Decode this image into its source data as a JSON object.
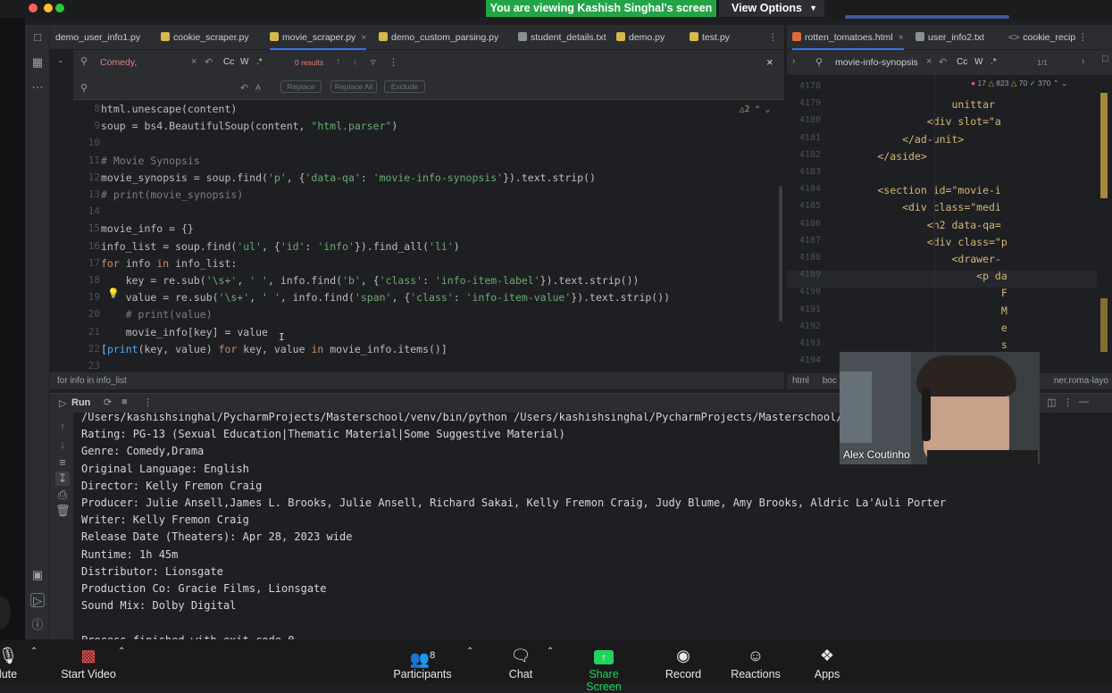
{
  "zoom": {
    "banner_text": "You are viewing Kashish Singhal's screen",
    "view_options_label": "View Options",
    "participant_name": "Alex Coutinho",
    "participant_count": "8",
    "toolbar": [
      {
        "label": "Mute",
        "icon": "microphone-icon",
        "shown": "lute"
      },
      {
        "label": "Start Video",
        "icon": "video-off-icon"
      },
      {
        "label": "Participants",
        "icon": "participants-icon"
      },
      {
        "label": "Chat",
        "icon": "chat-icon"
      },
      {
        "label": "Share Screen",
        "icon": "share-screen-icon"
      },
      {
        "label": "Record",
        "icon": "record-icon"
      },
      {
        "label": "Reactions",
        "icon": "reactions-icon"
      },
      {
        "label": "Apps",
        "icon": "apps-icon"
      }
    ]
  },
  "ide": {
    "tabs": [
      "demo_user_info1.py",
      "cookie_scraper.py",
      "movie_scraper.py",
      "demo_custom_parsing.py",
      "student_details.txt",
      "demo.py",
      "test.py"
    ],
    "active_tab": "movie_scraper.py",
    "search": {
      "find_value": "Comedy,",
      "results": "0 results",
      "replace_buttons": [
        "Replace",
        "Replace All",
        "Exclude"
      ],
      "option_case": "Cc",
      "option_word": "W",
      "option_regex": ".*"
    },
    "inspection_count": "2",
    "code_lines": [
      {
        "n": "8",
        "text": "html.unescape(content)"
      },
      {
        "n": "9",
        "text": "soup = bs4.BeautifulSoup(content, \"html.parser\")"
      },
      {
        "n": "10",
        "text": ""
      },
      {
        "n": "11",
        "text": "# Movie Synopsis"
      },
      {
        "n": "12",
        "text": "movie_synopsis = soup.find('p', {'data-qa': 'movie-info-synopsis'}).text.strip()"
      },
      {
        "n": "13",
        "text": "# print(movie_synopsis)"
      },
      {
        "n": "14",
        "text": ""
      },
      {
        "n": "15",
        "text": "movie_info = {}"
      },
      {
        "n": "16",
        "text": "info_list = soup.find('ul', {'id': 'info'}).find_all('li')"
      },
      {
        "n": "17",
        "text": "for info in info_list:"
      },
      {
        "n": "18",
        "text": "    key = re.sub('\\s+', ' ', info.find('b', {'class': 'info-item-label'}).text.strip())"
      },
      {
        "n": "19",
        "text": "    value = re.sub('\\s+', ' ', info.find('span', {'class': 'info-item-value'}).text.strip())"
      },
      {
        "n": "20",
        "text": "    # print(value)"
      },
      {
        "n": "21",
        "text": "    movie_info[key] = value"
      },
      {
        "n": "22",
        "text": "[print(key, value) for key, value in movie_info.items()]"
      },
      {
        "n": "23",
        "text": ""
      }
    ],
    "breadcrumb": "for info in info_list",
    "run_label": "Run",
    "output_lines": [
      "/Users/kashishsinghal/PycharmProjects/Masterschool/venv/bin/python /Users/kashishsinghal/PycharmProjects/Masterschool/w",
      "Rating: PG-13 (Sexual Education|Thematic Material|Some Suggestive Material)",
      "Genre: Comedy,Drama",
      "Original Language: English",
      "Director: Kelly Fremon Craig",
      "Producer: Julie Ansell,James L. Brooks, Julie Ansell, Richard Sakai, Kelly Fremon Craig, Judy Blume, Amy Brooks, Aldric La'Auli Porter",
      "Writer: Kelly Fremon Craig",
      "Release Date (Theaters): Apr 28, 2023 wide",
      "Runtime: 1h 45m",
      "Distributor: Lionsgate",
      "Production Co: Gracie Films, Lionsgate",
      "Sound Mix: Dolby Digital",
      "",
      "Process finished with exit code 0"
    ],
    "right_tabs": [
      "rotten_tomatoes.html",
      "user_info2.txt",
      "cookie_recip"
    ],
    "right_search": {
      "value": "movie-info-synopsis",
      "results": "1/1"
    },
    "right_stats": {
      "errors": "17",
      "warnings": "823",
      "weak": "70",
      "typos": "370"
    },
    "right_lines": [
      {
        "n": "4178",
        "text": ""
      },
      {
        "n": "4179",
        "text": "                    unittar"
      },
      {
        "n": "4180",
        "text": "                <div slot=\"a"
      },
      {
        "n": "4181",
        "text": "            </ad-unit>"
      },
      {
        "n": "4182",
        "text": "        </aside>"
      },
      {
        "n": "4183",
        "text": ""
      },
      {
        "n": "4184",
        "text": "        <section id=\"movie-i"
      },
      {
        "n": "4185",
        "text": "            <div class=\"medi"
      },
      {
        "n": "4186",
        "text": "                <h2 data-qa="
      },
      {
        "n": "4187",
        "text": "                <div class=\"p"
      },
      {
        "n": "4188",
        "text": "                    <drawer-"
      },
      {
        "n": "4189",
        "text": "                        <p da"
      },
      {
        "n": "4190",
        "text": "                            F"
      },
      {
        "n": "4191",
        "text": "                            M"
      },
      {
        "n": "4192",
        "text": "                            e"
      },
      {
        "n": "4193",
        "text": "                            s"
      },
      {
        "n": "4194",
        "text": "                            R"
      }
    ],
    "right_breadcrumb": [
      "html",
      "boc",
      "ner.roma-layo"
    ]
  }
}
